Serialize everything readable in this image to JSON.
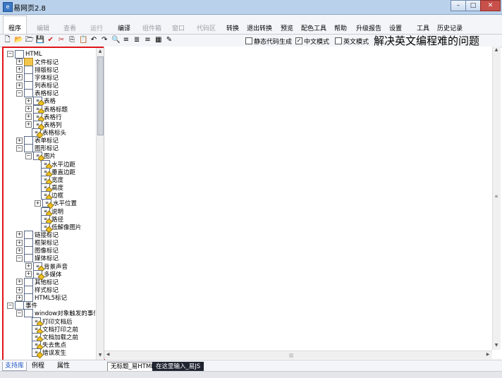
{
  "window": {
    "title": "易网页2.8",
    "minimize": "–",
    "maximize": "□",
    "close": "✕",
    "close_color": "#c7504a"
  },
  "menu": {
    "items": [
      {
        "label": "程序",
        "enabled": true
      },
      {
        "label": "编辑",
        "enabled": false
      },
      {
        "label": "查看",
        "enabled": false
      },
      {
        "label": "运行",
        "enabled": false
      },
      {
        "label": "编译",
        "enabled": true
      },
      {
        "label": "组件箱",
        "enabled": false
      },
      {
        "label": "窗口",
        "enabled": false
      },
      {
        "label": "代码区",
        "enabled": false
      },
      {
        "label": "转换",
        "enabled": true
      },
      {
        "label": "退出转换",
        "enabled": true
      },
      {
        "label": "预览",
        "enabled": true
      },
      {
        "label": "配色工具",
        "enabled": true
      },
      {
        "label": "帮助",
        "enabled": true
      },
      {
        "label": "升级报告",
        "enabled": true
      },
      {
        "label": "设置",
        "enabled": true
      },
      {
        "label": "工具",
        "enabled": true
      },
      {
        "label": "历史记录",
        "enabled": true
      }
    ]
  },
  "toolbar": {
    "icons": [
      "new-file-icon",
      "open-folder-icon",
      "open-icon",
      "save-icon",
      "check-icon",
      "cut-icon",
      "copy-icon",
      "paste-icon",
      "undo-icon",
      "redo-icon",
      "find-icon",
      "align-left-icon",
      "align-center-icon",
      "align-right-icon",
      "table-icon",
      "edit-icon"
    ],
    "options": [
      {
        "label": "静态代码生成",
        "checked": false
      },
      {
        "label": "中文模式",
        "checked": true
      },
      {
        "label": "英文模式",
        "checked": false
      }
    ],
    "banner": "解决英文编程难的问题"
  },
  "tree": [
    {
      "depth": 0,
      "toggle": "−",
      "icon": "html-icon",
      "label": "HTML"
    },
    {
      "depth": 1,
      "toggle": "+",
      "icon": "folder-icon",
      "label": "文件标记"
    },
    {
      "depth": 1,
      "toggle": "+",
      "icon": "layout-icon",
      "label": "排版标记"
    },
    {
      "depth": 1,
      "toggle": "+",
      "icon": "font-icon",
      "label": "字体标记"
    },
    {
      "depth": 1,
      "toggle": "+",
      "icon": "list-icon",
      "label": "列表标记"
    },
    {
      "depth": 1,
      "toggle": "−",
      "icon": "table-icon",
      "label": "表格标记"
    },
    {
      "depth": 2,
      "toggle": "+",
      "icon": "tag-icon",
      "label": "表格"
    },
    {
      "depth": 2,
      "toggle": "+",
      "icon": "tag-icon",
      "label": "表格标题"
    },
    {
      "depth": 2,
      "toggle": "+",
      "icon": "tag-icon",
      "label": "表格行"
    },
    {
      "depth": 2,
      "toggle": "+",
      "icon": "tag-icon",
      "label": "表格列"
    },
    {
      "depth": 2,
      "toggle": "",
      "icon": "tag-icon",
      "label": "表格标头"
    },
    {
      "depth": 1,
      "toggle": "+",
      "icon": "form-icon",
      "label": "表单标记"
    },
    {
      "depth": 1,
      "toggle": "−",
      "icon": "image-icon",
      "label": "图形标记"
    },
    {
      "depth": 2,
      "toggle": "−",
      "icon": "tag-icon",
      "label": "图片"
    },
    {
      "depth": 3,
      "toggle": "",
      "icon": "tag-icon",
      "label": "水平边距"
    },
    {
      "depth": 3,
      "toggle": "",
      "icon": "tag-icon",
      "label": "垂直边距"
    },
    {
      "depth": 3,
      "toggle": "",
      "icon": "tag-icon",
      "label": "宽度"
    },
    {
      "depth": 3,
      "toggle": "",
      "icon": "tag-icon",
      "label": "高度"
    },
    {
      "depth": 3,
      "toggle": "",
      "icon": "tag-icon",
      "label": "边框"
    },
    {
      "depth": 3,
      "toggle": "+",
      "icon": "tag-icon",
      "label": "水平位置"
    },
    {
      "depth": 3,
      "toggle": "",
      "icon": "tag-icon",
      "label": "说明"
    },
    {
      "depth": 3,
      "toggle": "",
      "icon": "tag-icon",
      "label": "路径"
    },
    {
      "depth": 3,
      "toggle": "",
      "icon": "tag-icon",
      "label": "低解像图片"
    },
    {
      "depth": 1,
      "toggle": "+",
      "icon": "link-icon",
      "label": "链接标记"
    },
    {
      "depth": 1,
      "toggle": "+",
      "icon": "frame-icon",
      "label": "框架标记"
    },
    {
      "depth": 1,
      "toggle": "+",
      "icon": "picture-icon",
      "label": "图像标记"
    },
    {
      "depth": 1,
      "toggle": "−",
      "icon": "media-icon",
      "label": "媒体标记"
    },
    {
      "depth": 2,
      "toggle": "+",
      "icon": "tag-icon",
      "label": "背景声音"
    },
    {
      "depth": 2,
      "toggle": "+",
      "icon": "tag-icon",
      "label": "多媒体"
    },
    {
      "depth": 1,
      "toggle": "+",
      "icon": "other-icon",
      "label": "其他标记"
    },
    {
      "depth": 1,
      "toggle": "+",
      "icon": "style-icon",
      "label": "样式标记"
    },
    {
      "depth": 1,
      "toggle": "+",
      "icon": "html5-icon",
      "label": "HTML5标记"
    },
    {
      "depth": 0,
      "toggle": "−",
      "icon": "event-icon",
      "label": "事件"
    },
    {
      "depth": 1,
      "toggle": "−",
      "icon": "event-icon",
      "label": "window对象触发的事件"
    },
    {
      "depth": 2,
      "toggle": "",
      "icon": "tag-icon",
      "label": "打印文档后"
    },
    {
      "depth": 2,
      "toggle": "",
      "icon": "tag-icon",
      "label": "文档打印之前"
    },
    {
      "depth": 2,
      "toggle": "",
      "icon": "tag-icon",
      "label": "文档加载之前"
    },
    {
      "depth": 2,
      "toggle": "",
      "icon": "tag-icon",
      "label": "失去焦点"
    },
    {
      "depth": 2,
      "toggle": "",
      "icon": "tag-icon",
      "label": "错误发生"
    }
  ],
  "bottom_tabs": [
    {
      "label": "支持库",
      "active": true
    },
    {
      "label": "例程",
      "active": false
    },
    {
      "label": "属性",
      "active": false
    }
  ],
  "editor_tabs": [
    {
      "label": "无标题_易HTML",
      "dark": false
    },
    {
      "label": "在这里输入_易JS",
      "dark": true
    }
  ],
  "highlight_color": "#e0141b"
}
